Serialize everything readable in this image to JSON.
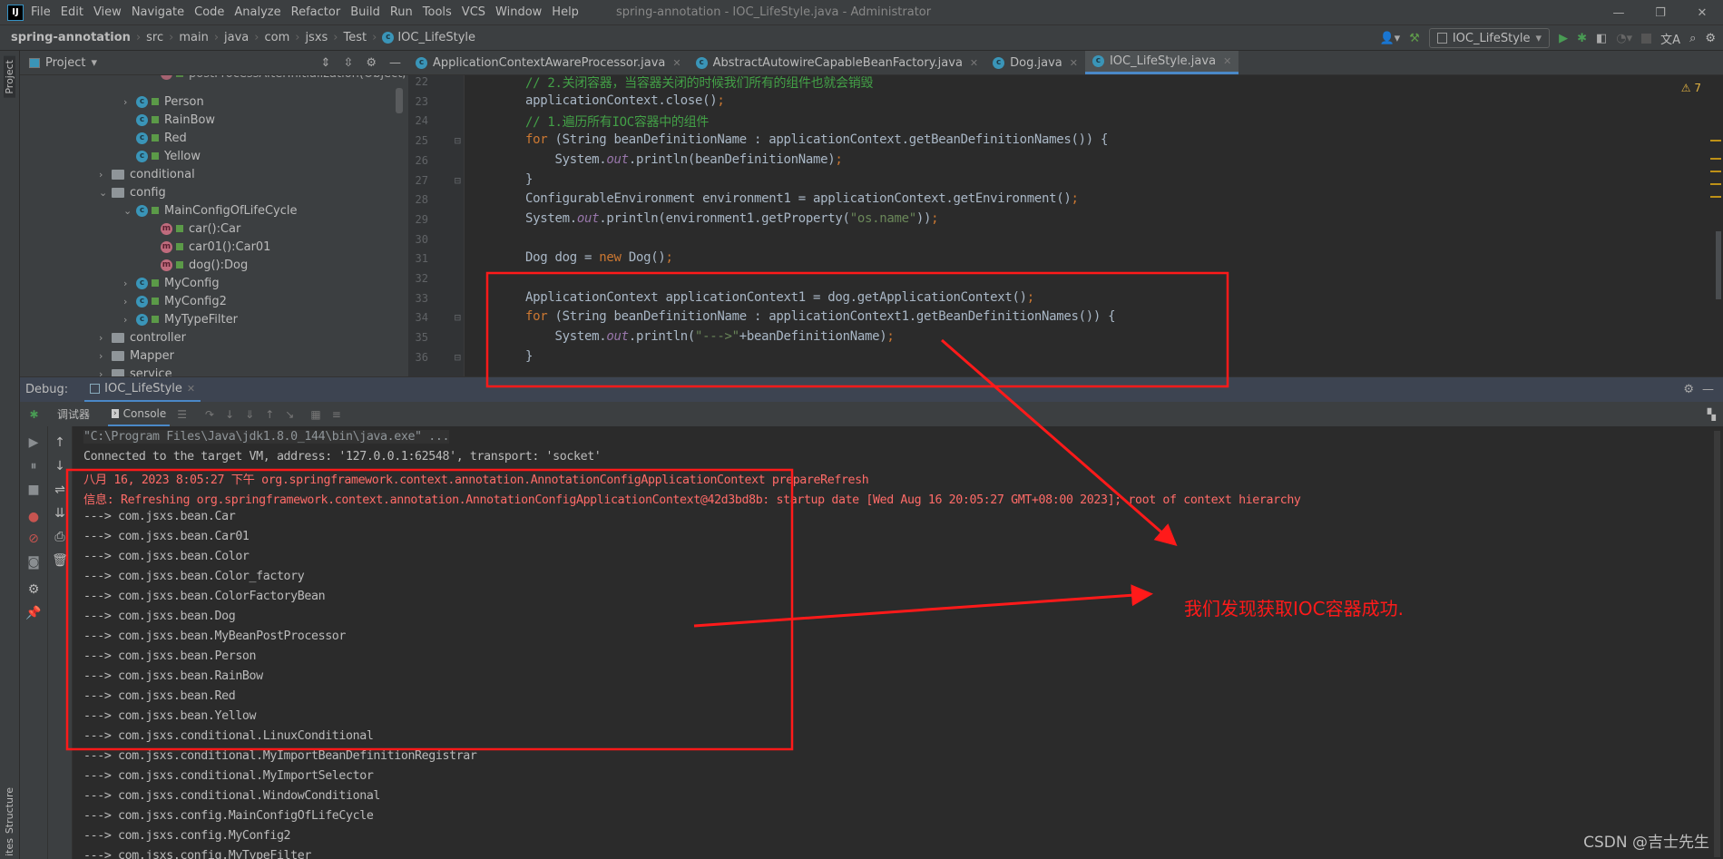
{
  "app": {
    "logo": "IJ",
    "window_title": "spring-annotation - IOC_LifeStyle.java - Administrator"
  },
  "menu": [
    "File",
    "Edit",
    "View",
    "Navigate",
    "Code",
    "Analyze",
    "Refactor",
    "Build",
    "Run",
    "Tools",
    "VCS",
    "Window",
    "Help"
  ],
  "window_controls": {
    "minimize": "—",
    "restore": "❐",
    "close": "✕"
  },
  "breadcrumb": [
    "spring-annotation",
    "src",
    "main",
    "java",
    "com",
    "jsxs",
    "Test",
    "IOC_LifeStyle"
  ],
  "run_config": "IOC_LifeStyle",
  "sidebar": {
    "project": "Project",
    "structure": "Structure",
    "favorites": "ites"
  },
  "project_panel": {
    "title": "Project"
  },
  "tree": [
    {
      "label": "postProcessAfterInitialization(Object,",
      "type": "method",
      "indent": 3,
      "chev": ""
    },
    {
      "label": "Person",
      "type": "class",
      "indent": 2,
      "chev": "›"
    },
    {
      "label": "RainBow",
      "type": "class",
      "indent": 2,
      "chev": ""
    },
    {
      "label": "Red",
      "type": "class",
      "indent": 2,
      "chev": ""
    },
    {
      "label": "Yellow",
      "type": "class",
      "indent": 2,
      "chev": ""
    },
    {
      "label": "conditional",
      "type": "folder",
      "indent": 1,
      "chev": "›"
    },
    {
      "label": "config",
      "type": "folder",
      "indent": 1,
      "chev": "⌄"
    },
    {
      "label": "MainConfigOfLifeCycle",
      "type": "class",
      "indent": 2,
      "chev": "⌄"
    },
    {
      "label": "car():Car",
      "type": "method",
      "indent": 3,
      "chev": ""
    },
    {
      "label": "car01():Car01",
      "type": "method",
      "indent": 3,
      "chev": ""
    },
    {
      "label": "dog():Dog",
      "type": "method",
      "indent": 3,
      "chev": ""
    },
    {
      "label": "MyConfig",
      "type": "class",
      "indent": 2,
      "chev": "›"
    },
    {
      "label": "MyConfig2",
      "type": "class",
      "indent": 2,
      "chev": "›"
    },
    {
      "label": "MyTypeFilter",
      "type": "class",
      "indent": 2,
      "chev": "›"
    },
    {
      "label": "controller",
      "type": "folder",
      "indent": 1,
      "chev": "›"
    },
    {
      "label": "Mapper",
      "type": "folder",
      "indent": 1,
      "chev": "›"
    },
    {
      "label": "service",
      "type": "folder",
      "indent": 1,
      "chev": "›"
    }
  ],
  "tabs": [
    {
      "label": "ApplicationContextAwareProcessor.java",
      "active": false
    },
    {
      "label": "AbstractAutowireCapableBeanFactory.java",
      "active": false
    },
    {
      "label": "Dog.java",
      "active": false
    },
    {
      "label": "IOC_LifeStyle.java",
      "active": true
    }
  ],
  "inspection": "⚠ 7",
  "code": [
    {
      "n": "22",
      "t": [
        [
          "cmz",
          "// 2.关闭容器，当容器关闭的时候我们所有的组件也就会销毁"
        ]
      ]
    },
    {
      "n": "23",
      "t": [
        [
          "",
          "applicationContext.close()"
        ],
        [
          "p",
          ";"
        ]
      ]
    },
    {
      "n": "24",
      "t": [
        [
          "cmz",
          "// 1.遍历所有IOC容器中的组件"
        ]
      ]
    },
    {
      "n": "25",
      "t": [
        [
          "k",
          "for "
        ],
        [
          "",
          "(String beanDefinitionName : applicationContext.getBeanDefinitionNames()) {"
        ]
      ]
    },
    {
      "n": "26",
      "t": [
        [
          "",
          "    System."
        ],
        [
          "f",
          "out"
        ],
        [
          "",
          ".println(beanDefinitionName)"
        ],
        [
          "p",
          ";"
        ]
      ]
    },
    {
      "n": "27",
      "t": [
        [
          "",
          "}"
        ]
      ]
    },
    {
      "n": "28",
      "t": [
        [
          "",
          "ConfigurableEnvironment environment1 = applicationContext.getEnvironment()"
        ],
        [
          "p",
          ";"
        ]
      ]
    },
    {
      "n": "29",
      "t": [
        [
          "",
          "System."
        ],
        [
          "f",
          "out"
        ],
        [
          "",
          ".println(environment1.getProperty("
        ],
        [
          "s",
          "\"os.name\""
        ],
        [
          "",
          "))"
        ],
        [
          "p",
          ";"
        ]
      ]
    },
    {
      "n": "30",
      "t": []
    },
    {
      "n": "31",
      "t": [
        [
          "",
          "Dog dog = "
        ],
        [
          "k",
          "new "
        ],
        [
          "",
          "Dog()"
        ],
        [
          "p",
          ";"
        ]
      ]
    },
    {
      "n": "32",
      "t": []
    },
    {
      "n": "33",
      "t": [
        [
          "",
          "ApplicationContext applicationContext1 = dog.getApplicationContext()"
        ],
        [
          "p",
          ";"
        ]
      ]
    },
    {
      "n": "34",
      "t": [
        [
          "k",
          "for "
        ],
        [
          "",
          "(String beanDefinitionName : applicationContext1.getBeanDefinitionNames()) {"
        ]
      ]
    },
    {
      "n": "35",
      "t": [
        [
          "",
          "    System."
        ],
        [
          "f",
          "out"
        ],
        [
          "",
          ".println("
        ],
        [
          "s",
          "\"--->\""
        ],
        [
          "",
          "+beanDefinitionName)"
        ],
        [
          "p",
          ";"
        ]
      ]
    },
    {
      "n": "36",
      "t": [
        [
          "",
          "}"
        ]
      ]
    }
  ],
  "debug": {
    "label": "Debug:",
    "tab": "IOC_LifeStyle",
    "debugger_tab": "调试器",
    "console_tab": "Console"
  },
  "console": [
    {
      "text": "\"C:\\Program Files\\Java\\jdk1.8.0_144\\bin\\java.exe\" ...",
      "style": "cmd"
    },
    {
      "text": "Connected to the target VM, address: '127.0.0.1:62548', transport: 'socket'",
      "style": ""
    },
    {
      "text": "八月 16, 2023 8:05:27 下午 org.springframework.context.annotation.AnnotationConfigApplicationContext prepareRefresh",
      "style": "red"
    },
    {
      "text": "信息: Refreshing org.springframework.context.annotation.AnnotationConfigApplicationContext@42d3bd8b: startup date [Wed Aug 16 20:05:27 GMT+08:00 2023]; root of context hierarchy",
      "style": "red"
    },
    {
      "text": "---> com.jsxs.bean.Car",
      "style": ""
    },
    {
      "text": "---> com.jsxs.bean.Car01",
      "style": ""
    },
    {
      "text": "---> com.jsxs.bean.Color",
      "style": ""
    },
    {
      "text": "---> com.jsxs.bean.Color_factory",
      "style": ""
    },
    {
      "text": "---> com.jsxs.bean.ColorFactoryBean",
      "style": ""
    },
    {
      "text": "---> com.jsxs.bean.Dog",
      "style": ""
    },
    {
      "text": "---> com.jsxs.bean.MyBeanPostProcessor",
      "style": ""
    },
    {
      "text": "---> com.jsxs.bean.Person",
      "style": ""
    },
    {
      "text": "---> com.jsxs.bean.RainBow",
      "style": ""
    },
    {
      "text": "---> com.jsxs.bean.Red",
      "style": ""
    },
    {
      "text": "---> com.jsxs.bean.Yellow",
      "style": ""
    },
    {
      "text": "---> com.jsxs.conditional.LinuxConditional",
      "style": ""
    },
    {
      "text": "---> com.jsxs.conditional.MyImportBeanDefinitionRegistrar",
      "style": ""
    },
    {
      "text": "---> com.jsxs.conditional.MyImportSelector",
      "style": ""
    },
    {
      "text": "---> com.jsxs.conditional.WindowConditional",
      "style": ""
    },
    {
      "text": "---> com.jsxs.config.MainConfigOfLifeCycle",
      "style": ""
    },
    {
      "text": "---> com.jsxs.config.MyConfig2",
      "style": ""
    },
    {
      "text": "---> com.jsxs.config.MyTypeFilter",
      "style": ""
    }
  ],
  "annotation": {
    "text": "我们发现获取IOC容器成功.",
    "color": "#ff1a1a"
  },
  "watermark": "CSDN @吉士先生",
  "colors": {
    "accent": "#4a88c7",
    "highlight_box": "#ff1a1a",
    "console_error": "#ff6b68"
  }
}
